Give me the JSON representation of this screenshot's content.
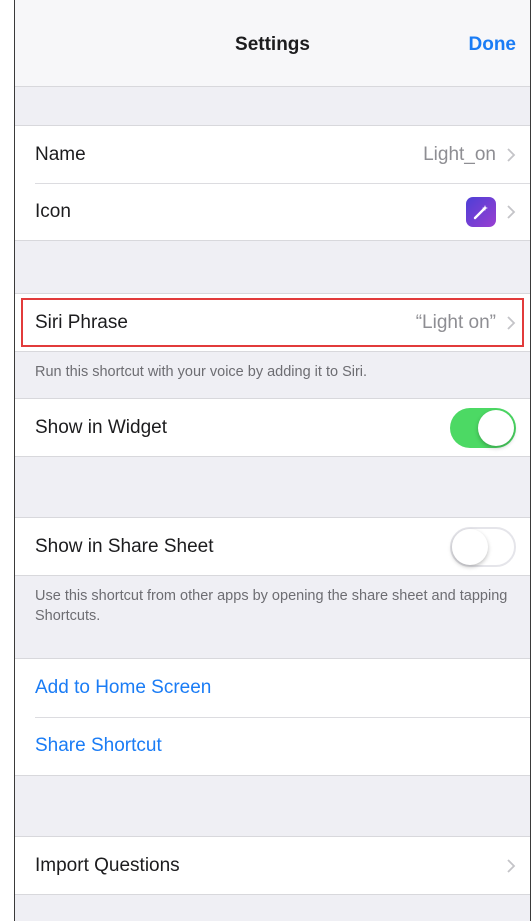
{
  "navbar": {
    "title": "Settings",
    "done_label": "Done"
  },
  "general": {
    "name_label": "Name",
    "name_value": "Light_on",
    "icon_label": "Icon",
    "icon_glyph": "magic-wand-icon",
    "icon_color": "#6a3fd6"
  },
  "siri": {
    "label": "Siri Phrase",
    "value": "“Light on”",
    "footnote": "Run this shortcut with your voice by adding it to Siri.",
    "highlight_color": "#e23b3b"
  },
  "widget": {
    "label": "Show in Widget",
    "enabled": true,
    "on_color": "#4cd964"
  },
  "share_sheet": {
    "label": "Show in Share Sheet",
    "enabled": false,
    "footnote": "Use this shortcut from other apps by opening the share sheet and tapping Shortcuts."
  },
  "actions": {
    "add_home": "Add to Home Screen",
    "share": "Share Shortcut",
    "link_color": "#1a7cf5"
  },
  "import": {
    "label": "Import Questions"
  }
}
